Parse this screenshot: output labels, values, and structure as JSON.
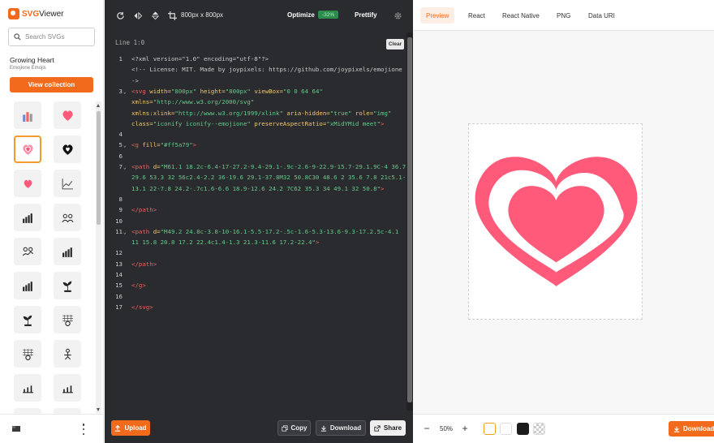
{
  "brand": {
    "prefix": "SVG",
    "suffix": "Viewer"
  },
  "search": {
    "placeholder": "Search SVGs"
  },
  "collection": {
    "title": "Growing Heart",
    "subtitle": "Emojione Emojis",
    "button": "View collection"
  },
  "editor": {
    "toolbar": {
      "dimensions": "800px x 800px",
      "optimize": "Optimize",
      "optimize_badge": "-32%",
      "prettify": "Prettify"
    },
    "position": "Line 1:0",
    "clear": "Clear",
    "lines": [
      {
        "n": "1",
        "segs": [
          {
            "c": "c-cm",
            "t": "<?xml version=\"1.0\" encoding=\"utf-8\"?>"
          }
        ]
      },
      {
        "n": "",
        "segs": [
          {
            "c": "c-cm",
            "t": "<!-- License: MIT. Made by joypixels: https://github.com/joypixels/emojione -"
          }
        ]
      },
      {
        "n": "",
        "segs": [
          {
            "c": "c-cm",
            "t": "->"
          }
        ]
      },
      {
        "n": "3",
        "fold": true,
        "segs": [
          {
            "c": "c-tag",
            "t": "<svg "
          },
          {
            "c": "c-attr",
            "t": "width="
          },
          {
            "c": "c-val",
            "t": "\"800px\" "
          },
          {
            "c": "c-attr",
            "t": "height="
          },
          {
            "c": "c-val",
            "t": "\"800px\" "
          },
          {
            "c": "c-attr",
            "t": "viewBox="
          },
          {
            "c": "c-val",
            "t": "\"0 0 64 64\""
          }
        ]
      },
      {
        "n": "",
        "segs": [
          {
            "c": "c-attr",
            "t": "xmlns="
          },
          {
            "c": "c-val",
            "t": "\"http://www.w3.org/2000/svg\""
          }
        ]
      },
      {
        "n": "",
        "segs": [
          {
            "c": "c-attr",
            "t": "xmlns:xlink="
          },
          {
            "c": "c-val",
            "t": "\"http://www.w3.org/1999/xlink\" "
          },
          {
            "c": "c-attr",
            "t": "aria-hidden="
          },
          {
            "c": "c-val",
            "t": "\"true\" "
          },
          {
            "c": "c-attr",
            "t": "role="
          },
          {
            "c": "c-val",
            "t": "\"img\""
          }
        ]
      },
      {
        "n": "",
        "segs": [
          {
            "c": "c-attr",
            "t": "class="
          },
          {
            "c": "c-val",
            "t": "\"iconify iconify--emojione\" "
          },
          {
            "c": "c-attr",
            "t": "preserveAspectRatio="
          },
          {
            "c": "c-val",
            "t": "\"xMidYMid meet\""
          },
          {
            "c": "c-tag",
            "t": ">"
          }
        ]
      },
      {
        "n": "4",
        "segs": []
      },
      {
        "n": "5",
        "fold": true,
        "segs": [
          {
            "c": "c-tag",
            "t": "<g "
          },
          {
            "c": "c-attr",
            "t": "fill="
          },
          {
            "c": "c-val",
            "t": "\"#ff5a79\""
          },
          {
            "c": "c-tag",
            "t": ">"
          }
        ]
      },
      {
        "n": "6",
        "segs": []
      },
      {
        "n": "7",
        "fold": true,
        "segs": [
          {
            "c": "c-tag",
            "t": "<path "
          },
          {
            "c": "c-attr",
            "t": "d="
          },
          {
            "c": "c-val",
            "t": "\"M61.1 18.2c-6.4-17-27.2-9.4-29.1-.9c-2.6-9-22.9-15.7-29.1.9C-4 36.7"
          }
        ]
      },
      {
        "n": "",
        "segs": [
          {
            "c": "c-val",
            "t": "29.6 53.3 32 56c2.4-2.2 36-19.6 29.1-37.8M32 50.8C30 48.6 2 35.6 7.8 21c5.1-"
          }
        ]
      },
      {
        "n": "",
        "segs": [
          {
            "c": "c-val",
            "t": "13.1 22-7.8 24.2-.7c1.6-6.6 18.9-12.6 24.2 7C62 35.3 34 49.1 32 50.8\""
          },
          {
            "c": "c-tag",
            "t": ">"
          }
        ]
      },
      {
        "n": "8",
        "segs": []
      },
      {
        "n": "9",
        "segs": [
          {
            "c": "c-tag",
            "t": "</path>"
          }
        ]
      },
      {
        "n": "10",
        "segs": []
      },
      {
        "n": "11",
        "fold": true,
        "segs": [
          {
            "c": "c-tag",
            "t": "<path "
          },
          {
            "c": "c-attr",
            "t": "d="
          },
          {
            "c": "c-val",
            "t": "\"M49.2 24.8c-3.8-10-16.1-5.5-17.2-.5c-1.6-5.3-13.6-9.3-17.2.5c-4.1"
          }
        ]
      },
      {
        "n": "",
        "segs": [
          {
            "c": "c-val",
            "t": "11 15.8 20.8 17.2 22.4c1.4-1.3 21.3-11.6 17.2-22.4\""
          },
          {
            "c": "c-tag",
            "t": ">"
          }
        ]
      },
      {
        "n": "12",
        "segs": []
      },
      {
        "n": "13",
        "segs": [
          {
            "c": "c-tag",
            "t": "</path>"
          }
        ]
      },
      {
        "n": "14",
        "segs": []
      },
      {
        "n": "15",
        "segs": [
          {
            "c": "c-tag",
            "t": "</g>"
          }
        ]
      },
      {
        "n": "16",
        "segs": []
      },
      {
        "n": "17",
        "segs": [
          {
            "c": "c-tag",
            "t": "</svg>"
          }
        ]
      }
    ],
    "footer": {
      "upload": "Upload",
      "copy": "Copy",
      "download": "Download",
      "share": "Share"
    }
  },
  "preview": {
    "tabs": [
      "Preview",
      "React",
      "React Native",
      "PNG",
      "Data URI"
    ],
    "active_tab": "Preview",
    "heart_color": "#ff5a79",
    "zoom": "50%",
    "download": "Download",
    "backgrounds": [
      "white-outline",
      "white",
      "black",
      "checker"
    ]
  },
  "colors": {
    "accent": "#f26a1b",
    "editor_bg": "#2a2b2e"
  },
  "sidebar_icons": [
    "bar-chart-color-icon",
    "heart-icon",
    "heart-outline-icon",
    "heart-black-icon",
    "heart-small-icon",
    "line-chart-icon",
    "bar-chart-icon",
    "people-icon",
    "people-chart-icon",
    "bar-chart-icon",
    "bar-chart-icon",
    "plant-icon",
    "plant-icon",
    "grid-globe-icon",
    "grid-globe-icon",
    "person-up-icon",
    "chart-trend-icon",
    "chart-trend-icon",
    "chart-icon",
    "chart-icon"
  ]
}
